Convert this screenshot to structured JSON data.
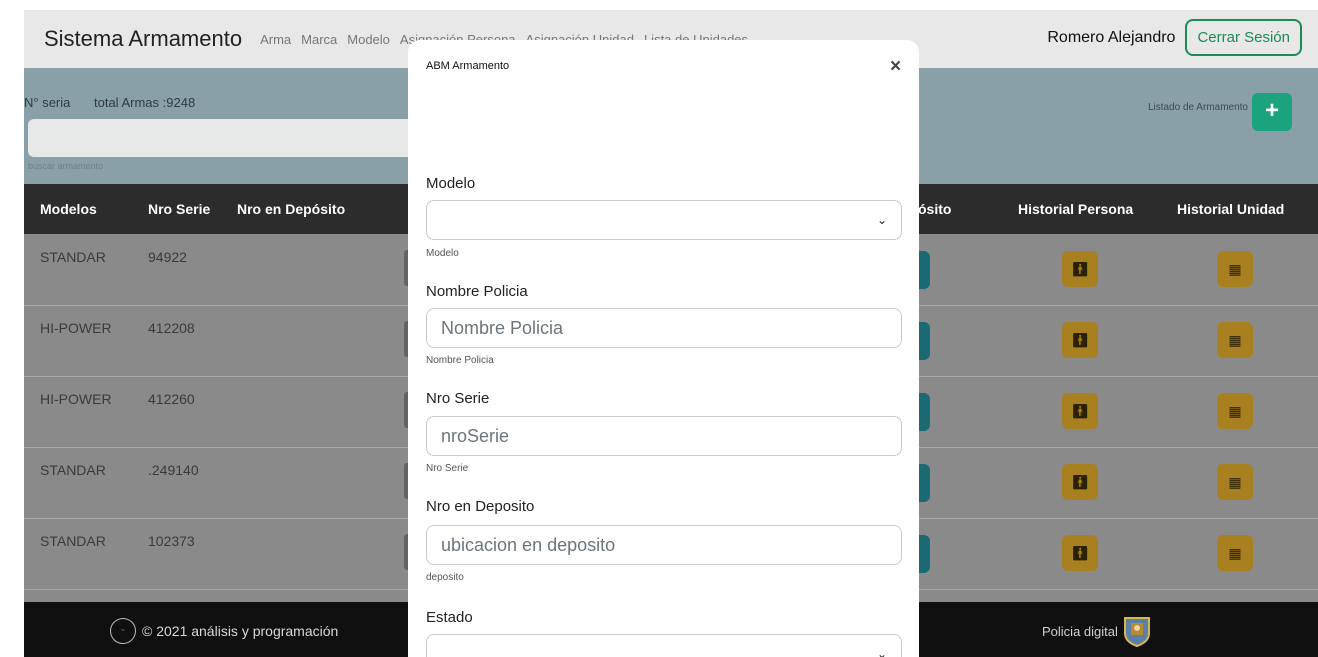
{
  "navbar": {
    "brand": "Sistema Armamento",
    "links": [
      "Arma",
      "Marca",
      "Modelo",
      "Asignación Persona",
      "Asignación Unidad",
      "Lista de Unidades"
    ],
    "user": "Romero Alejandro",
    "logout_label": "Cerrar Sesión"
  },
  "panel": {
    "serial_label": "N° seria",
    "total_label": "total Armas :9248",
    "list_label": "Listado de Armamento",
    "add_icon": "+",
    "search_hint": "buscar armamento"
  },
  "table": {
    "headers": [
      "Modelos",
      "Nro Serie",
      "Nro en Depósito",
      "ósito",
      "Historial Persona",
      "Historial Unidad"
    ],
    "rows": [
      {
        "modelo": "STANDAR",
        "serie": "94922"
      },
      {
        "modelo": "HI-POWER",
        "serie": "412208"
      },
      {
        "modelo": "HI-POWER",
        "serie": "412260"
      },
      {
        "modelo": "STANDAR",
        "serie": ".249140"
      },
      {
        "modelo": "STANDAR",
        "serie": "102373"
      }
    ],
    "person_icon": "person-icon",
    "building_icon": "building-icon"
  },
  "footer": {
    "copyright": "© 2021 análisis y programación",
    "right_text": "Policia digital"
  },
  "modal": {
    "title": "ABM Armamento",
    "close": "×",
    "fields": {
      "modelo": {
        "label": "Modelo",
        "value": "",
        "help": "Modelo"
      },
      "nombre": {
        "label": "Nombre Policia",
        "placeholder": "Nombre Policia",
        "help": "Nombre Policia"
      },
      "serie": {
        "label": "Nro Serie",
        "placeholder": "nroSerie",
        "help": "Nro Serie"
      },
      "deposito": {
        "label": "Nro en Deposito",
        "placeholder": "ubicacion en deposito",
        "help": "deposito"
      },
      "estado": {
        "label": "Estado",
        "value": ""
      }
    },
    "chevron": "⌄"
  }
}
